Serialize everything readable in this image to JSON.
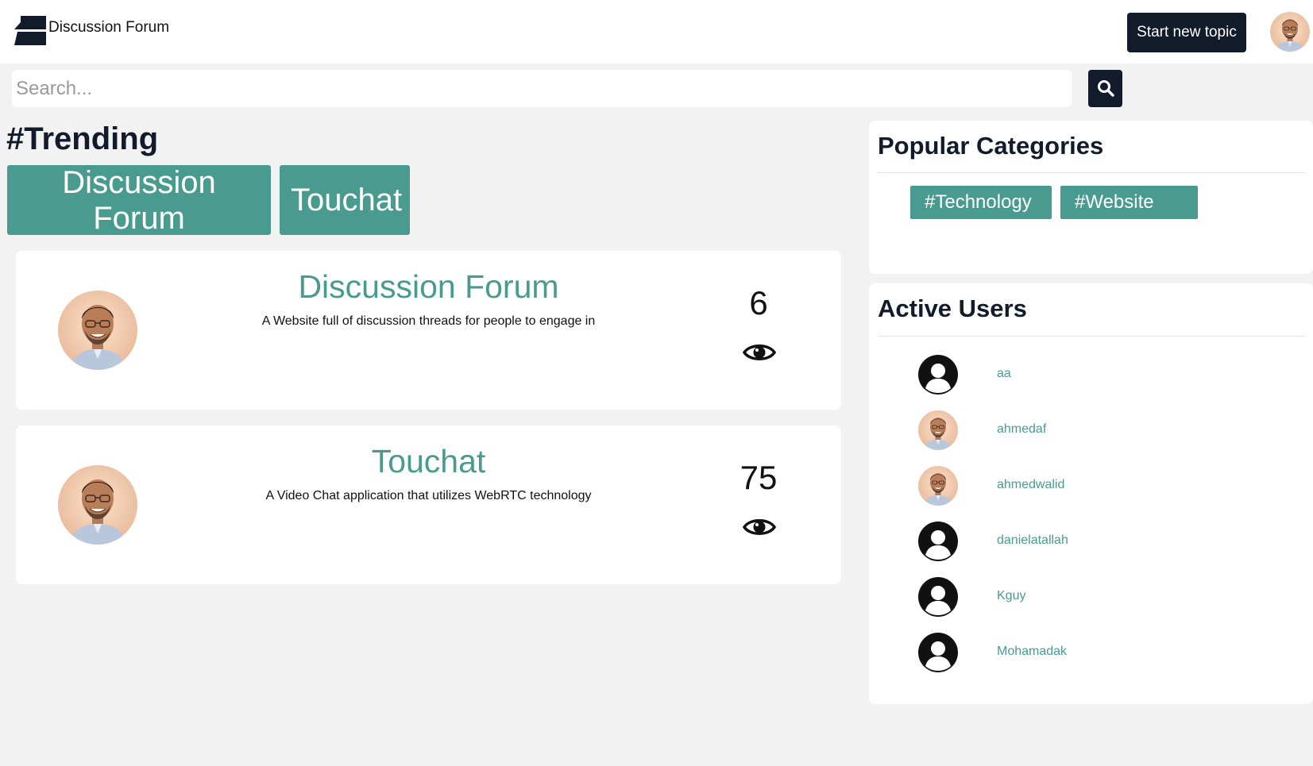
{
  "header": {
    "brand": "Discussion Forum",
    "start_topic_label": "Start new topic"
  },
  "search": {
    "placeholder": "Search..."
  },
  "trending": {
    "title": "#Trending",
    "tags": [
      "Discussion Forum",
      "Touchat"
    ]
  },
  "topics": [
    {
      "title": "Discussion Forum",
      "description": "A Website full of discussion threads for people to engage in",
      "views": "6"
    },
    {
      "title": "Touchat",
      "description": "A Video Chat application that utilizes WebRTC technology",
      "views": "75"
    }
  ],
  "popular_categories": {
    "title": "Popular Categories",
    "items": [
      "#Technology",
      "#Website"
    ]
  },
  "active_users": {
    "title": "Active Users",
    "users": [
      {
        "name": "aa",
        "avatar": "default-user-icon"
      },
      {
        "name": "ahmedaf",
        "avatar": "photo"
      },
      {
        "name": "ahmedwalid",
        "avatar": "photo"
      },
      {
        "name": "danielatallah",
        "avatar": "default-user-icon"
      },
      {
        "name": "Kguy",
        "avatar": "default-user-icon"
      },
      {
        "name": "Mohamadak",
        "avatar": "default-user-icon"
      }
    ]
  },
  "colors": {
    "accent": "#4a9b8f",
    "dark": "#111b2b",
    "background": "#f2f2f2"
  }
}
